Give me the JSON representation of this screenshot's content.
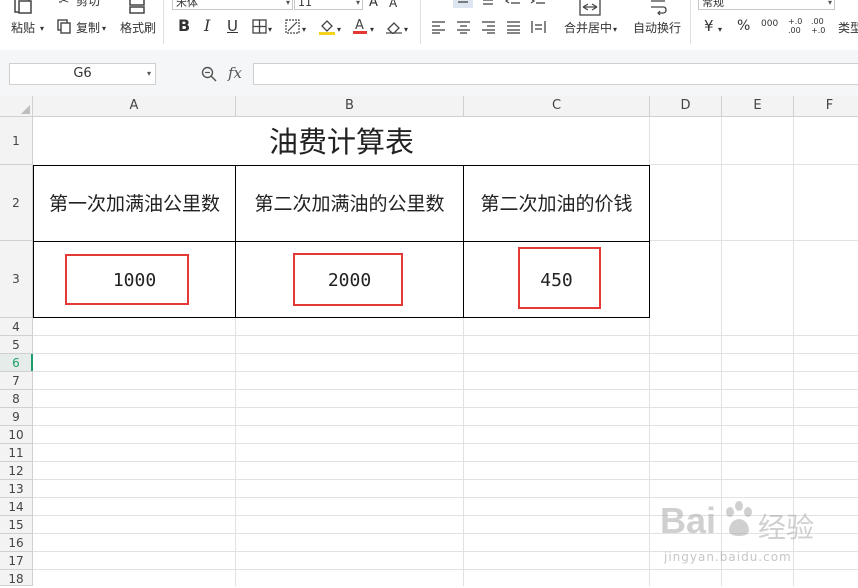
{
  "ribbon": {
    "paste": "粘贴",
    "cut": "剪切",
    "copy": "复制",
    "format_painter": "格式刷",
    "font_name": "宋体",
    "font_size": "11",
    "bold": "B",
    "italic": "I",
    "underline": "U",
    "merge_center": "合并居中",
    "wrap_text": "自动换行",
    "number_format": "常规",
    "currency": "¥",
    "percent": "%",
    "thousands": "000",
    "increase_decimal": "+.0 .00",
    "decrease_decimal": ".00 +.0",
    "type_convert": "类型"
  },
  "formula_bar": {
    "name_box": "G6",
    "fx": "fx",
    "formula": ""
  },
  "grid": {
    "columns": [
      "A",
      "B",
      "C",
      "D",
      "E",
      "F"
    ],
    "rows": [
      "1",
      "2",
      "3",
      "4",
      "5",
      "6",
      "7",
      "8",
      "9",
      "10",
      "11",
      "12",
      "13",
      "14",
      "15",
      "16",
      "17",
      "18"
    ],
    "active_row": "6"
  },
  "sheet": {
    "title": "油费计算表",
    "headers": [
      "第一次加满油公里数",
      "第二次加满油的公里数",
      "第二次加油的价钱"
    ],
    "values": [
      "1000",
      "2000",
      "450"
    ]
  },
  "watermark": {
    "brand": "Bai",
    "brand2": "经验",
    "url": "jingyan.baidu.com"
  },
  "colors": {
    "highlight_border": "#e53935",
    "active_row": "#1e9e6a",
    "grid_line": "#e2e2e2"
  }
}
